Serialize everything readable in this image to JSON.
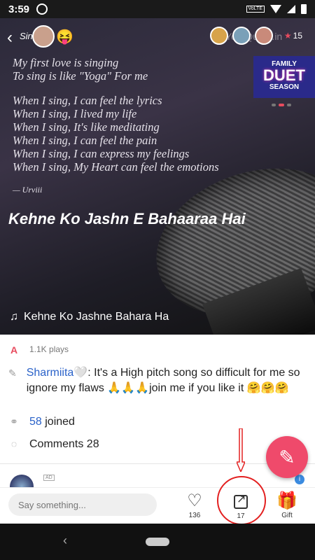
{
  "status_bar": {
    "time": "3:59",
    "network": "VoLTE"
  },
  "header": {
    "singer_label": "Sing",
    "listener_count": "15",
    "watermark": "YourQuote.in"
  },
  "poem": {
    "lines_a": [
      "My first love is singing",
      "To sing is like \"Yoga\" For me"
    ],
    "lines_b": [
      "When I sing, I can feel the lyrics",
      "When I sing, I lived my life",
      "When I sing, It's like meditating",
      "When I sing, I can feel the pain",
      "When I sing, I can express my feelings",
      "When I sing, My Heart can feel the emotions"
    ],
    "author": "— Urviii"
  },
  "banner": {
    "line1": "FAMILY",
    "line2": "DUET",
    "line3": "SEASON"
  },
  "song": {
    "title": "Kehne Ko Jashn E Bahaaraa Hai",
    "now_playing": "Kehne Ko Jashne Bahara Ha"
  },
  "details": {
    "plays_icon": "A",
    "plays": "1.1K plays",
    "user": "Sharmiita🤍",
    "description": ": It's a High pitch song so difficult for me so ignore my flaws 🙏🙏🙏join me if you like it 🤗🤗🤗",
    "joined_count": "58",
    "joined_label": " joined",
    "comments_label": "Comments 28",
    "ad_tag": "AD"
  },
  "bottom": {
    "input_placeholder": "Say something...",
    "like_count": "136",
    "share_count": "17",
    "gift_label": "Gift"
  },
  "colors": {
    "accent": "#ef4a6b",
    "link": "#2a62c9",
    "annotation": "#e32020"
  }
}
